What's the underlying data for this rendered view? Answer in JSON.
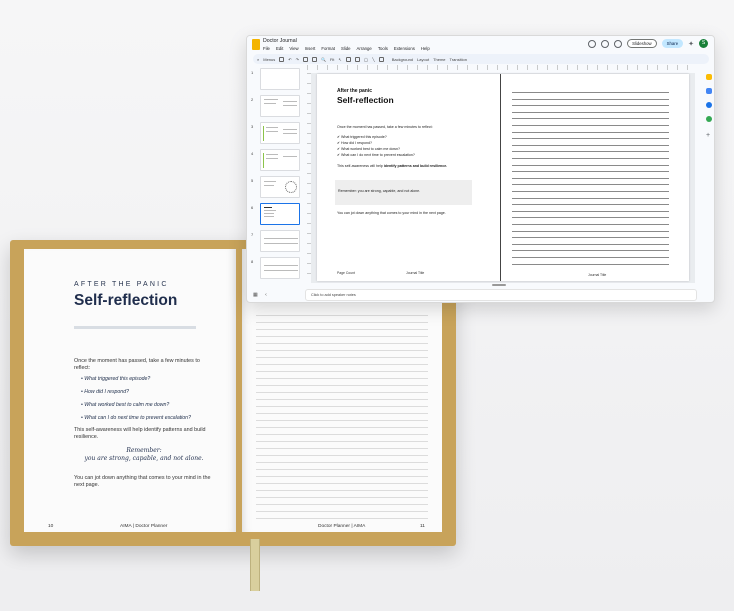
{
  "book": {
    "eyebrow": "AFTER THE PANIC",
    "title": "Self-reflection",
    "intro": "Once the moment has passed, take a few minutes to reflect:",
    "questions": [
      "What triggered this episode?",
      "How did I respond?",
      "What worked best to calm me down?",
      "What can I do next time to prevent escalation?"
    ],
    "awareness": "This self-awareness will help identify patterns and build resilience.",
    "reminder_1": "Remember:",
    "reminder_2": "you are strong, capable, and not alone.",
    "jot": "You can jot down anything that comes to your mind in the next page.",
    "left_page_number": "10",
    "left_footer": "AIMA | Doctor Planner",
    "right_footer": "Doctor Planner | AIMA",
    "right_page_number": "11"
  },
  "app": {
    "doc_title": "Doctor Journal",
    "menu": [
      "File",
      "Edit",
      "View",
      "Insert",
      "Format",
      "Slide",
      "Arrange",
      "Tools",
      "Extensions",
      "Help"
    ],
    "slideshow_label": "Slideshow",
    "share_label": "Share",
    "avatar_letter": "S",
    "toolbar": {
      "menus_label": "Menus",
      "fit_label": "Fit",
      "background_label": "Background",
      "layout_label": "Layout",
      "theme_label": "Theme",
      "transition_label": "Transition"
    },
    "slide_numbers": [
      "1",
      "2",
      "3",
      "4",
      "5",
      "6",
      "7",
      "8"
    ],
    "speaker_notes_placeholder": "Click to add speaker notes"
  },
  "slide": {
    "eyebrow": "After the panic",
    "title": "Self-reflection",
    "intro": "Once the moment has passed, take a few minutes to reflect:",
    "checklist": [
      "What triggered this episode?",
      "How did I respond?",
      "What worked best to calm me down?",
      "What can I do next time to prevent escalation?"
    ],
    "awareness_prefix": "This self-awareness will help ",
    "awareness_bold": "identify patterns and build resilience.",
    "remember": "Remember: you are strong, capable, and not alone.",
    "jot": "You can jot down anything that comes to your mind in the next page.",
    "footer_left": "Page Count",
    "footer_mid": "Journal Title",
    "footer_right": "Journal Title"
  },
  "colors": {
    "accent": "#1a73e8",
    "share": "#c2e7ff",
    "book_cover": "#c8a35a",
    "navy": "#1f2d4c"
  }
}
